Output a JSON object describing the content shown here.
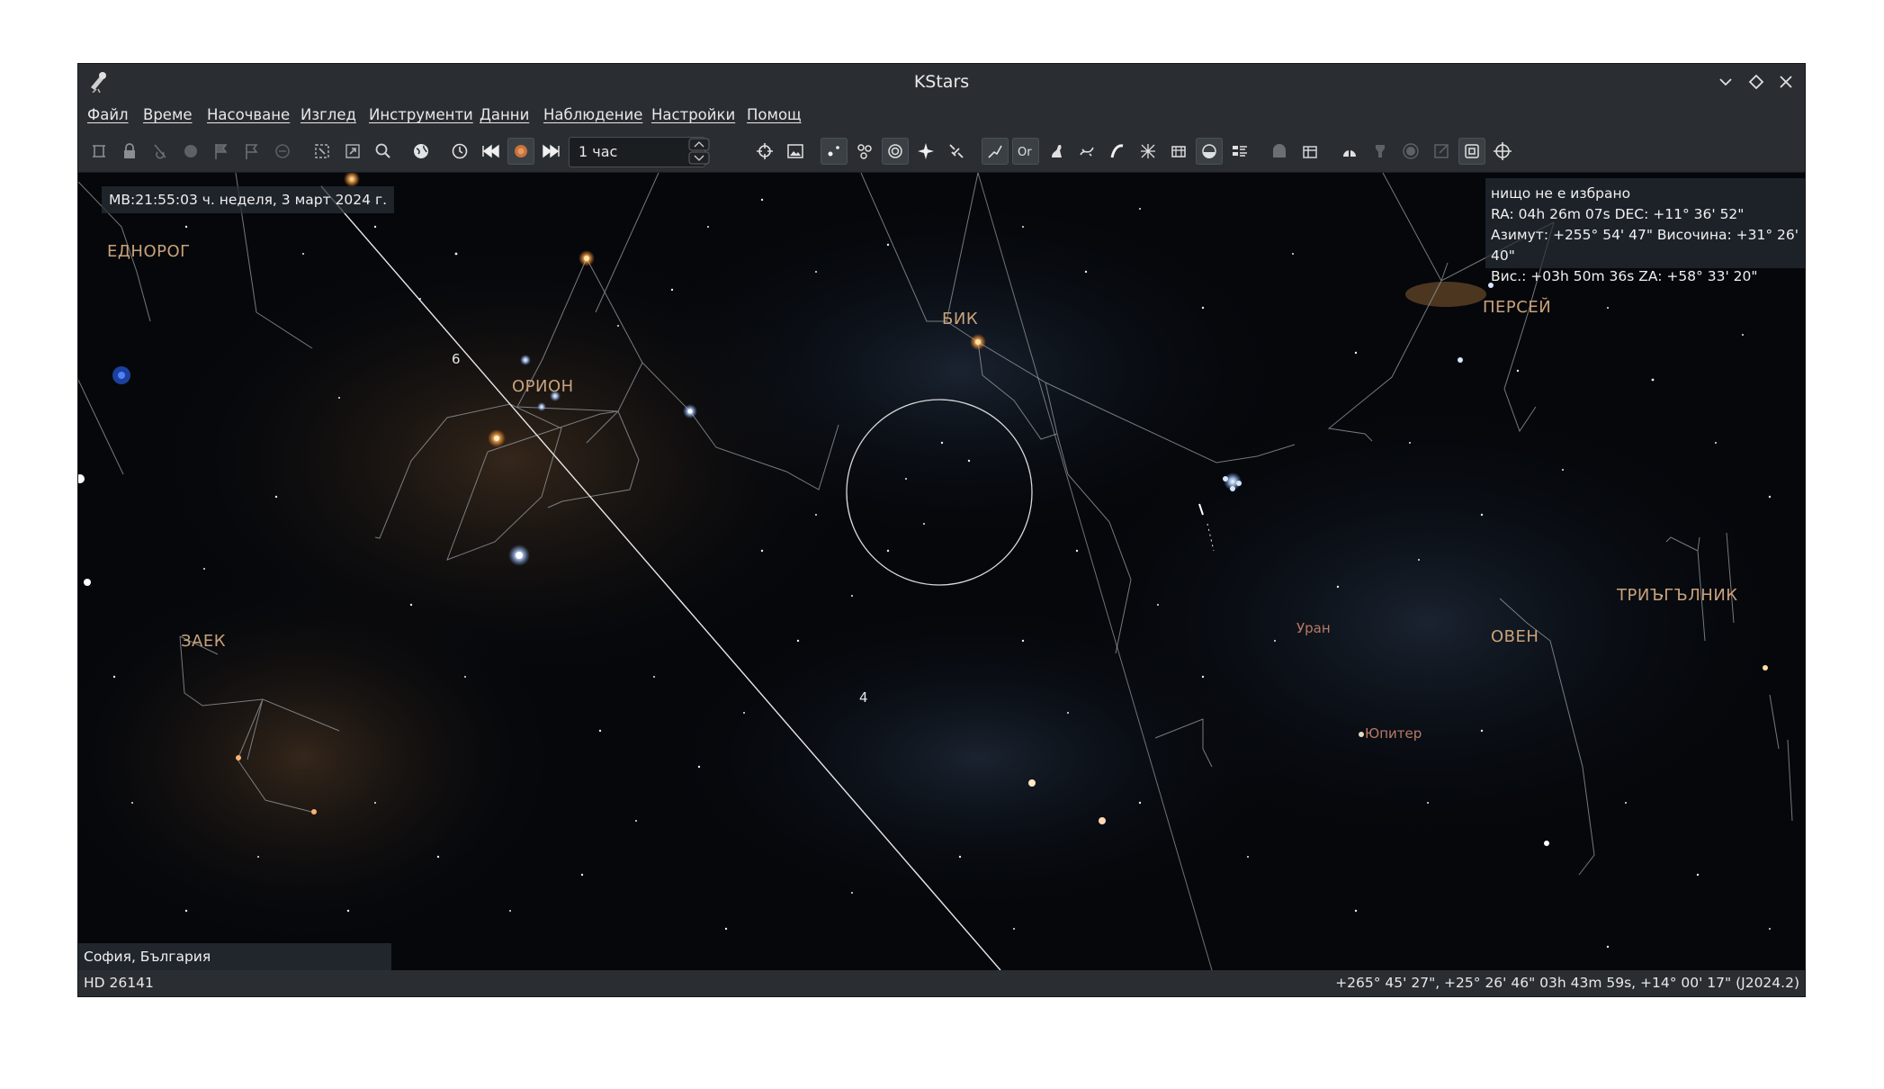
{
  "window": {
    "title": "KStars"
  },
  "menu": [
    "Файл",
    "Време",
    "Насочване",
    "Изглед",
    "Инструменти",
    "Данни",
    "Наблюдение",
    "Настройки",
    "Помощ"
  ],
  "toolbar": {
    "time_step": "1 час",
    "icons": [
      "home-icon",
      "lock-icon",
      "track-icon",
      "circle-icon",
      "flag-icon",
      "flag-add-icon",
      "minus-circle-icon",
      "zoom-fit-icon",
      "zoom-region-icon",
      "search-icon",
      "globe-icon",
      "clock-icon",
      "rewind-icon",
      "stop-icon",
      "fast-forward-icon",
      "crosshair-icon",
      "image-icon",
      "stars-icon",
      "deep-sky-icon",
      "galaxy-icon",
      "solar-system-icon",
      "satellite-icon",
      "constellation-lines-icon",
      "constellation-names-icon",
      "constellation-art-icon",
      "milky-way-icon",
      "ecliptic-icon",
      "equator-icon",
      "horizon-icon",
      "ground-icon",
      "columns-icon",
      "observatory-icon",
      "telescope-icon",
      "dome-icon",
      "filter-icon",
      "camera-icon",
      "export-icon",
      "fov-icon",
      "target-icon"
    ]
  },
  "sky": {
    "clock": "МВ:21:55:03 ч.   неделя, 3 март 2024 г.",
    "info": {
      "line1": "нищо не е избрано",
      "line2": "RA: 04h 26m 07s  DEC: +11° 36' 52\"",
      "line3": "Азимут: +255° 54' 47\"  Височина: +31° 26' 40\"",
      "line4": "Вис.: +03h 50m 36s  ZA: +58° 33' 20\""
    },
    "location": "София, България",
    "constellations": [
      "ЕДНОРОГ",
      "ОРИОН",
      "БИК",
      "ПЕРСЕЙ",
      "ЗАЕК",
      "ТРИЪГЪЛНИК",
      "ОВЕН"
    ],
    "planets": [
      "Уран",
      "Юпитер"
    ],
    "markers": [
      "6",
      "4"
    ]
  },
  "status": {
    "object": "HD 26141",
    "coords": "+265° 45' 27\", +25° 26' 46\"  03h 43m 59s, +14° 00' 17\" (J2024.2)"
  },
  "colors": {
    "chrome": "#2a2e32",
    "sky": "#05070b",
    "constellation_name": "#c9a27a",
    "planet_label": "#b97a66"
  }
}
